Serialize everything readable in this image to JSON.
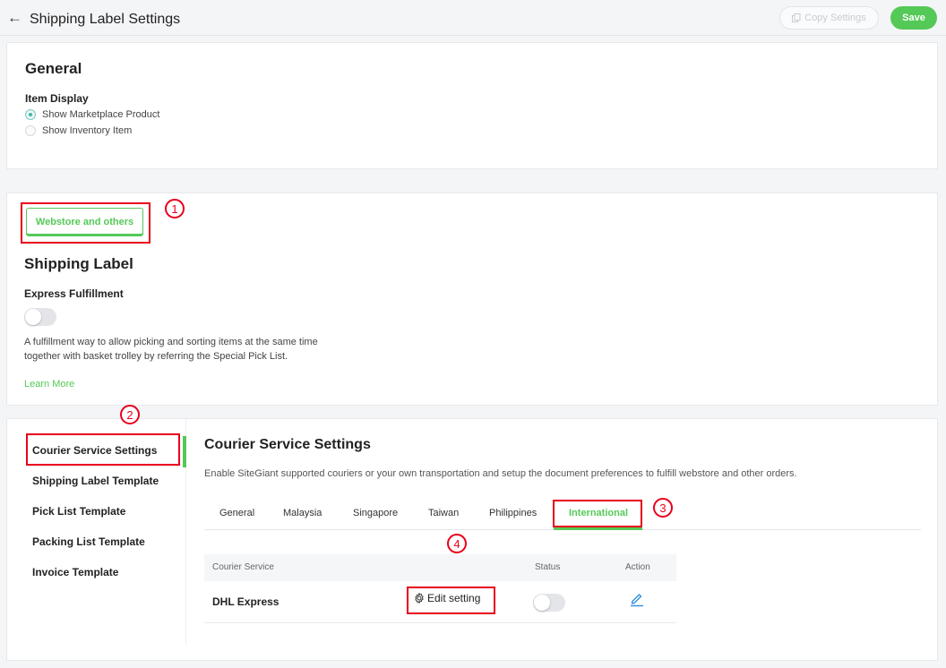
{
  "header": {
    "back_icon": "arrow-left-icon",
    "title": "Shipping Label Settings",
    "copy_label": "Copy Settings",
    "save_label": "Save"
  },
  "general": {
    "title": "General",
    "item_display_label": "Item Display",
    "options": [
      {
        "label": "Show Marketplace Product",
        "selected": true
      },
      {
        "label": "Show Inventory Item",
        "selected": false
      }
    ]
  },
  "shipping": {
    "channel_button": "Webstore and others",
    "title": "Shipping Label",
    "express_label": "Express Fulfillment",
    "express_enabled": false,
    "express_description": "A fulfillment way to allow picking and sorting items at the same time together with basket trolley by referring the Special Pick List.",
    "learn_more": "Learn More"
  },
  "annotations": [
    "1",
    "2",
    "3",
    "4"
  ],
  "sidebar": {
    "items": [
      {
        "label": "Courier Service Settings",
        "active": true
      },
      {
        "label": "Shipping Label Template",
        "active": false
      },
      {
        "label": "Pick List Template",
        "active": false
      },
      {
        "label": "Packing List Template",
        "active": false
      },
      {
        "label": "Invoice Template",
        "active": false
      }
    ]
  },
  "courier": {
    "title": "Courier Service Settings",
    "description": "Enable SiteGiant supported couriers or your own transportation and setup the document preferences to fulfill webstore and other orders.",
    "tabs": [
      {
        "label": "General",
        "active": false
      },
      {
        "label": "Malaysia",
        "active": false
      },
      {
        "label": "Singapore",
        "active": false
      },
      {
        "label": "Taiwan",
        "active": false
      },
      {
        "label": "Philippines",
        "active": false
      },
      {
        "label": "International",
        "active": true
      }
    ],
    "table": {
      "columns": [
        "Courier Service",
        "Status",
        "Action"
      ],
      "rows": [
        {
          "name": "DHL Express",
          "edit_label": "Edit setting",
          "status_enabled": false
        }
      ]
    }
  },
  "colors": {
    "accent": "#54c957",
    "annotation_red": "#e8001c"
  }
}
